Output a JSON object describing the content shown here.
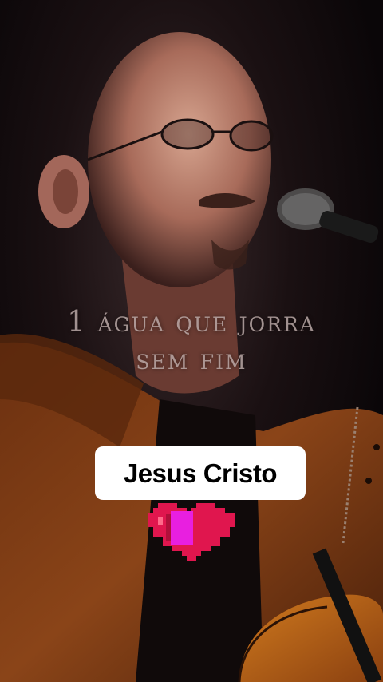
{
  "overlay": {
    "lyric_line1": "1 água que jorra",
    "lyric_line2": "sem fim",
    "caption": "Jesus Cristo",
    "heart_icon": "pixel-heart-icon"
  },
  "colors": {
    "lyric": "#b9a8a6",
    "caption_bg": "#ffffff",
    "caption_text": "#000000",
    "heart_red": "#e0164e",
    "heart_magenta": "#e81fe0",
    "jacket": "#7a3a14"
  }
}
